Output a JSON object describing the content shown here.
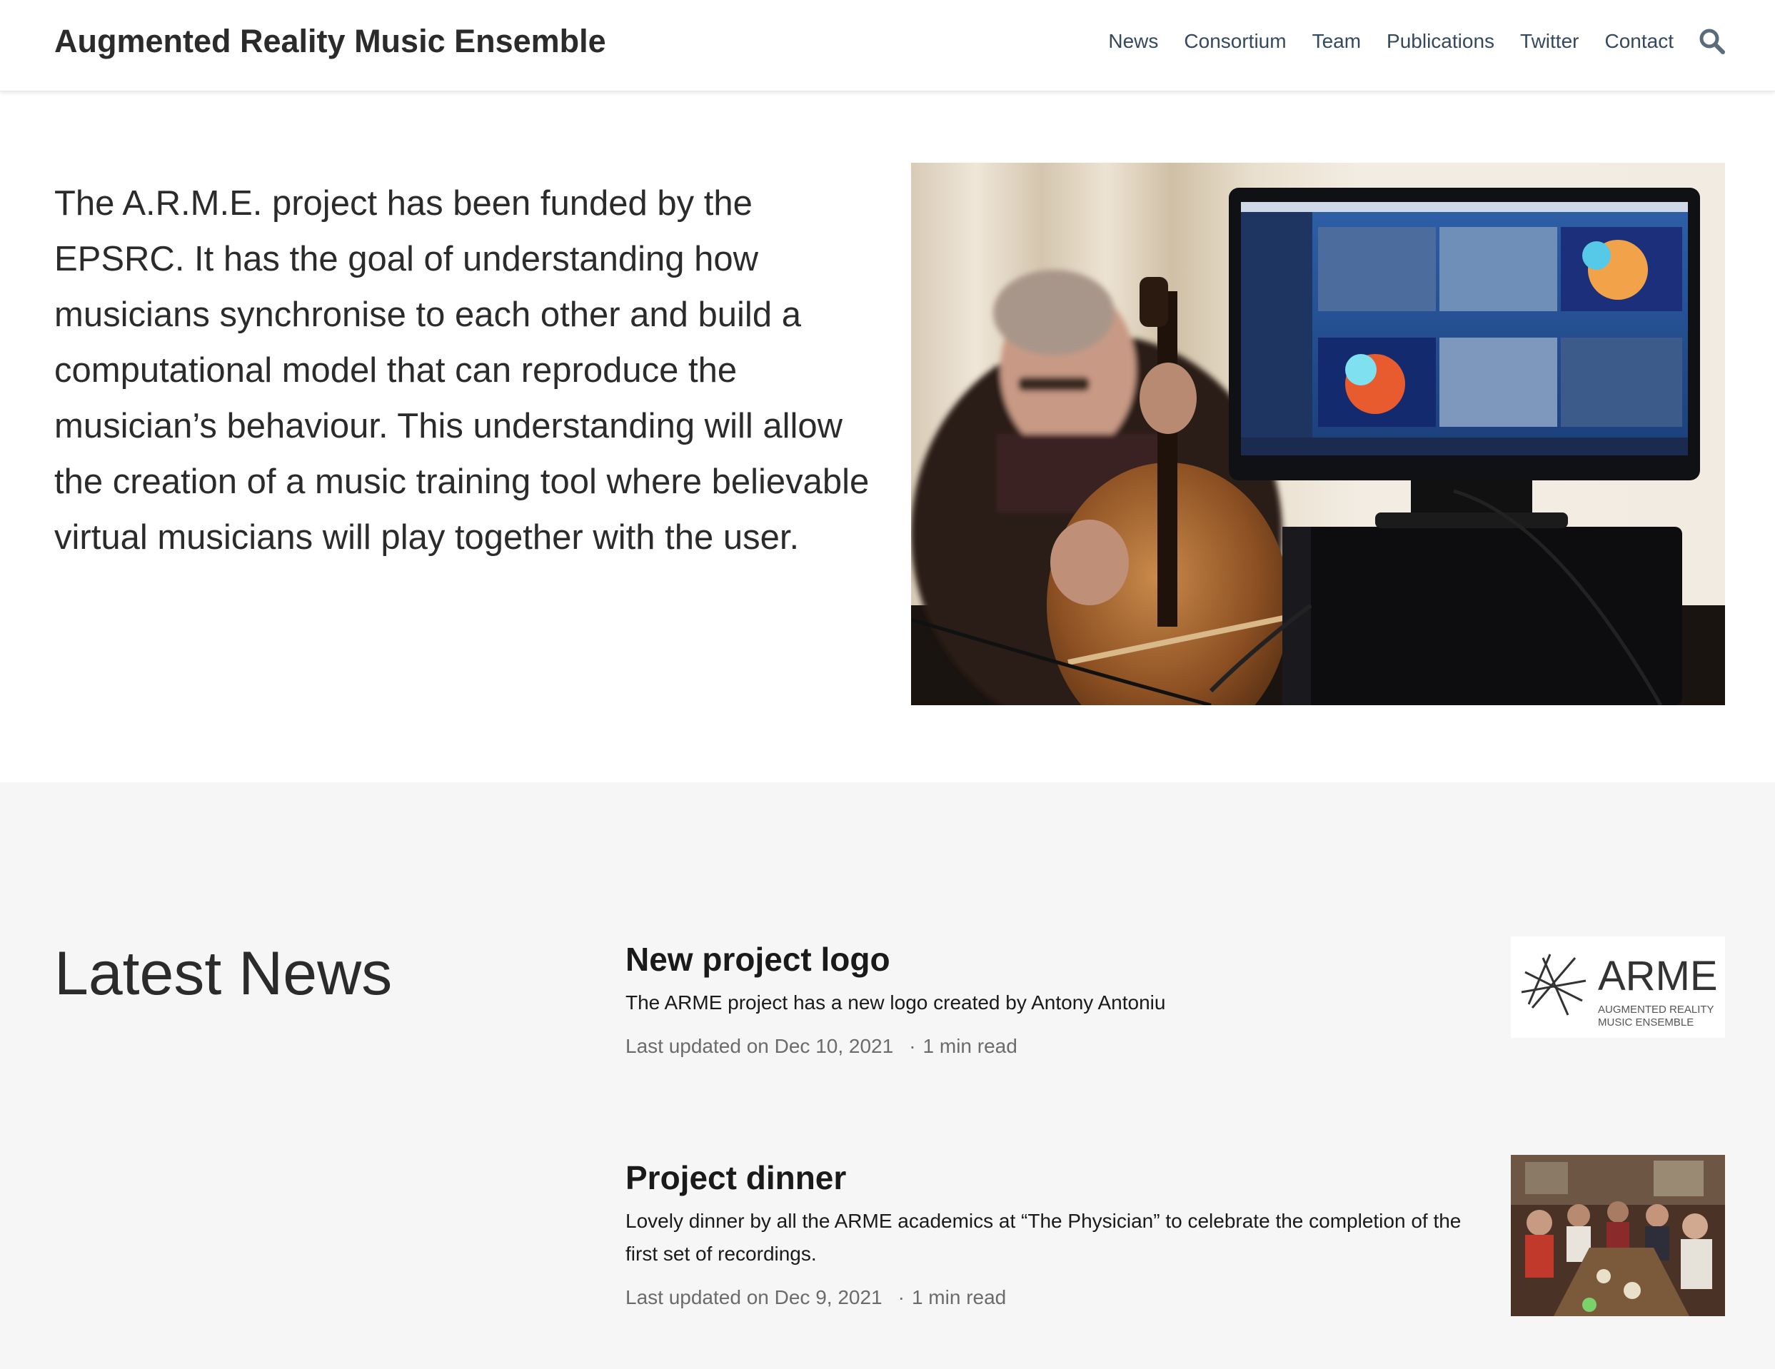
{
  "site": {
    "title": "Augmented Reality Music Ensemble"
  },
  "nav": {
    "items": [
      "News",
      "Consortium",
      "Team",
      "Publications",
      "Twitter",
      "Contact"
    ],
    "search_icon": "search-icon"
  },
  "hero": {
    "text": "The A.R.M.E. project has been funded by the EPSRC. It has the goal of understanding how musicians synchronise to each other and build a computational model that can reproduce the musician’s behaviour. This understanding will allow the creation of a music training tool where believable virtual musicians will play together with the user.",
    "image": "cellist-playing-next-to-monitor-with-depth-camera-streams"
  },
  "news": {
    "heading": "Latest News",
    "posts": [
      {
        "title": "New project logo",
        "summary": "The ARME project has a new logo created by Antony Antoniu",
        "updated": "Last updated on Dec 10, 2021",
        "read_time": "1 min read",
        "thumb": "arme-logo",
        "logo_text": "ARME",
        "logo_sub_1": "AUGMENTED REALITY",
        "logo_sub_2": "MUSIC ENSEMBLE"
      },
      {
        "title": "Project dinner",
        "summary": "Lovely dinner by all the ARME academics at “The Physician” to celebrate the completion of the first set of recordings.",
        "updated": "Last updated on Dec 9, 2021",
        "read_time": "1 min read",
        "thumb": "group-dinner-photo"
      }
    ]
  },
  "colors": {
    "text": "#2b2b2b",
    "nav_link": "#34495e",
    "meta": "#6b6b6b",
    "section_bg": "#f6f6f6"
  }
}
